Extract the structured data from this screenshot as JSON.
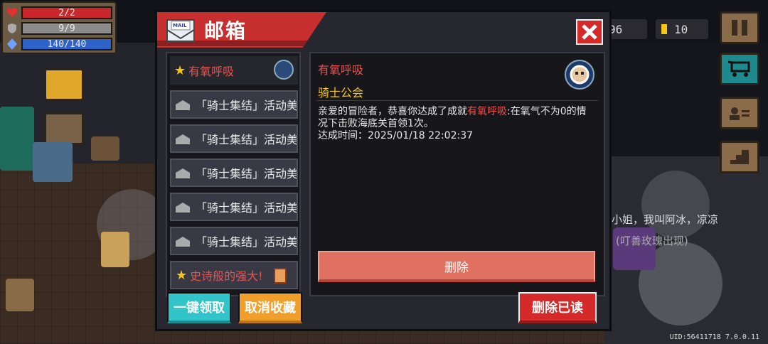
{
  "hud": {
    "hp": "2/2",
    "armor": "9/9",
    "energy": "140/140"
  },
  "top_right": {
    "gems": "96",
    "coins": "10"
  },
  "mailbox": {
    "title": "邮箱",
    "mail_icon_text": "MAIL",
    "mails": [
      {
        "label": "有氧呼吸",
        "starred": true
      },
      {
        "label": "「骑士集结」活动美"
      },
      {
        "label": "「骑士集结」活动美"
      },
      {
        "label": "「骑士集结」活动美"
      },
      {
        "label": "「骑士集结」活动美"
      },
      {
        "label": "「骑士集结」活动美"
      },
      {
        "label": "史诗般的强大!",
        "starred": true
      }
    ],
    "detail": {
      "title": "有氧呼吸",
      "sender": "骑士公会",
      "body_pre": "亲爱的冒险者，恭喜你达成了成就",
      "body_highlight": "有氧呼吸",
      "body_post": ":在氧气不为0的情况下击败海底关首领1次。",
      "time_label": "达成时间：",
      "time_value": "2025/01/18 22:02:37",
      "delete_button": "删除"
    },
    "buttons": {
      "claim_all": "一键领取",
      "unfavorite": "取消收藏",
      "delete_read": "删除已读"
    }
  },
  "background_text": {
    "npc_line1": "小姐，我叫阿冰，凉凉",
    "npc_line2": "(叮善玫瑰出现)"
  },
  "uid": "UID:56411718 7.0.0.11"
}
